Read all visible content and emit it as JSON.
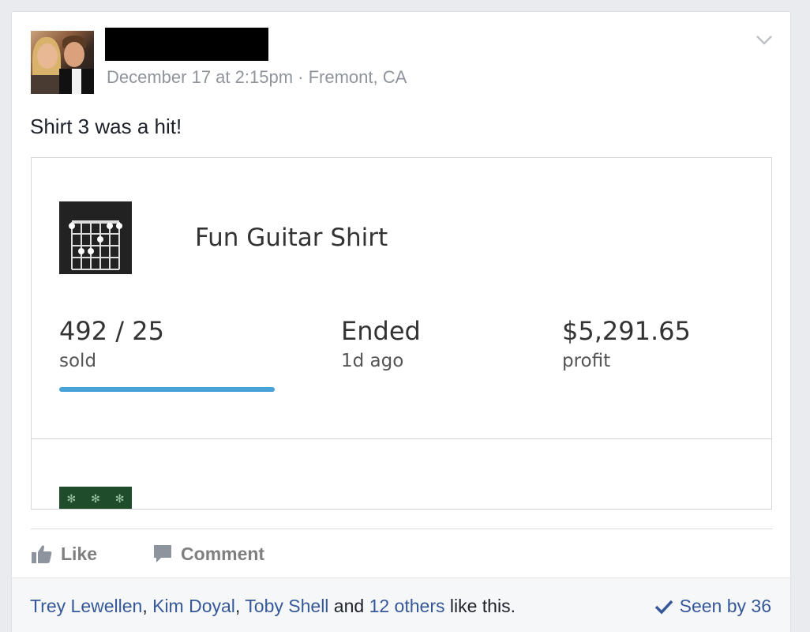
{
  "post": {
    "timestamp": "December 17 at 2:15pm",
    "separator": "·",
    "location": "Fremont, CA",
    "text": "Shirt 3 was a hit!"
  },
  "card": {
    "title": "Fun Guitar Shirt",
    "sold_count": "492 / 25",
    "sold_label": "sold",
    "status": "Ended",
    "status_time": "1d ago",
    "profit": "$5,291.65",
    "profit_label": "profit",
    "progress_fraction": 1.0
  },
  "actions": {
    "like_label": "Like",
    "comment_label": "Comment"
  },
  "likes": {
    "user1": "Trey Lewellen",
    "comma1": ", ",
    "user2": "Kim Doyal",
    "comma2": ", ",
    "user3": "Toby Shell",
    "and": " and ",
    "others": "12 others",
    "suffix": " like this.",
    "seen_by": "Seen by 36"
  },
  "colors": {
    "link": "#365899",
    "meta": "#90949c",
    "progress": "#4aa3d8"
  },
  "icons": [
    "chevron-down-icon",
    "guitar-chord-icon",
    "thumbs-up-icon",
    "comment-icon",
    "checkmark-icon"
  ]
}
